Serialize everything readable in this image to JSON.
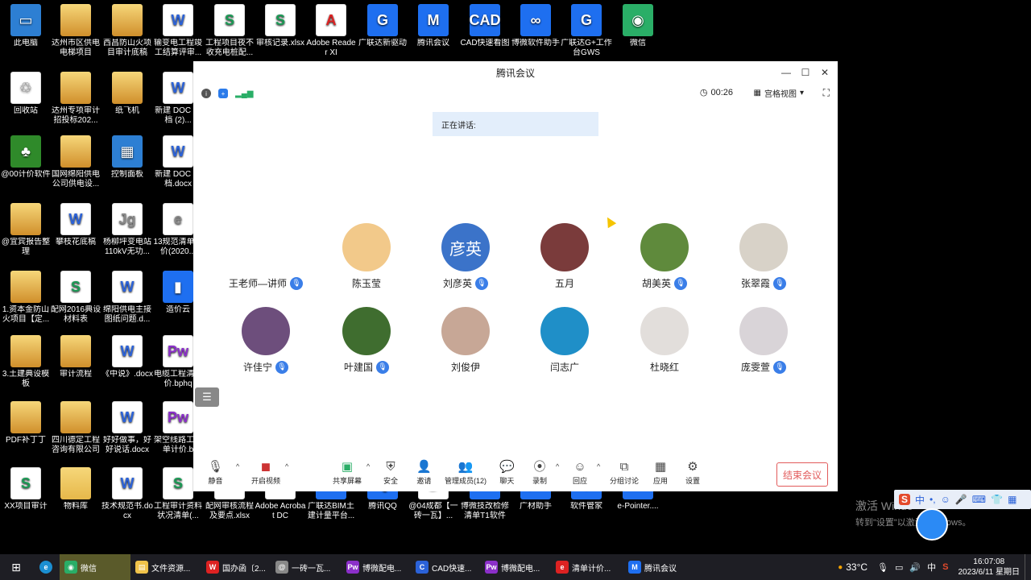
{
  "desktop_icons": [
    {
      "label": "此电脑",
      "type": "t-pc",
      "glyph": "▭"
    },
    {
      "label": "达州市区供电电梯项目",
      "type": "t-zip",
      "glyph": ""
    },
    {
      "label": "西昌防山火项目审计底稿",
      "type": "t-zip",
      "glyph": ""
    },
    {
      "label": "输变电工程竣工结算评审...",
      "type": "t-wps",
      "glyph": "W"
    },
    {
      "label": "工程项目夜不收充电桩配...",
      "type": "t-xls",
      "glyph": "S"
    },
    {
      "label": "审核记录.xlsx",
      "type": "t-xls",
      "glyph": "S"
    },
    {
      "label": "Adobe Reader XI",
      "type": "t-pdf",
      "glyph": "A"
    },
    {
      "label": "广联达新驱动",
      "type": "t-app",
      "glyph": "G"
    },
    {
      "label": "腾讯会议",
      "type": "t-app",
      "glyph": "M"
    },
    {
      "label": "CAD快速看图",
      "type": "t-app",
      "glyph": "CAD"
    },
    {
      "label": "博微软件助手",
      "type": "t-app",
      "glyph": "∞"
    },
    {
      "label": "广联达G+工作台GWS",
      "type": "t-app",
      "glyph": "G"
    },
    {
      "label": "微信",
      "type": "t-green",
      "glyph": "◉"
    },
    {
      "label": "回收站",
      "type": "t-doc",
      "glyph": "♲"
    },
    {
      "label": "达州专项审计招投标202...",
      "type": "t-zip",
      "glyph": ""
    },
    {
      "label": "纸飞机",
      "type": "t-zip",
      "glyph": ""
    },
    {
      "label": "新建 DOC 文档 (2)...",
      "type": "t-wps",
      "glyph": "W"
    },
    {
      "label": "@00计价软件",
      "type": "t-tree",
      "glyph": "♣"
    },
    {
      "label": "国网绵阳供电公司供电设...",
      "type": "t-zip",
      "glyph": ""
    },
    {
      "label": "控制面板",
      "type": "t-pc",
      "glyph": "▦"
    },
    {
      "label": "新建 DOC 文档.docx",
      "type": "t-wps",
      "glyph": "W"
    },
    {
      "label": "@宜宾报告整理",
      "type": "t-zip",
      "glyph": ""
    },
    {
      "label": "攀枝花底稿",
      "type": "t-wps",
      "glyph": "W"
    },
    {
      "label": "杨柳坪变电站110kV无功...",
      "type": "t-doc",
      "glyph": "Jg"
    },
    {
      "label": "13规范清单计价(2020...",
      "type": "t-doc",
      "glyph": "e"
    },
    {
      "label": "1.资本金防山火项目【定...",
      "type": "t-zip",
      "glyph": ""
    },
    {
      "label": "配网2016典设材料表",
      "type": "t-xls",
      "glyph": "S"
    },
    {
      "label": "绵阳供电主接图纸问题.d...",
      "type": "t-wps",
      "glyph": "W"
    },
    {
      "label": "造价云",
      "type": "t-app",
      "glyph": "▮"
    },
    {
      "label": "3.土建典设模板",
      "type": "t-zip",
      "glyph": ""
    },
    {
      "label": "审计流程",
      "type": "t-zip",
      "glyph": ""
    },
    {
      "label": "《中说》.docx",
      "type": "t-wps",
      "glyph": "W"
    },
    {
      "label": "电缆工程清计价.bphq",
      "type": "t-pw",
      "glyph": "Pw"
    },
    {
      "label": "PDF补丁丁",
      "type": "t-zip",
      "glyph": ""
    },
    {
      "label": "四川德定工程咨询有限公司",
      "type": "t-zip",
      "glyph": ""
    },
    {
      "label": "好好做事，好好说话.docx",
      "type": "t-wps",
      "glyph": "W"
    },
    {
      "label": "架空线路工清单计价.b",
      "type": "t-pw",
      "glyph": "Pw"
    },
    {
      "label": "XX项目审计",
      "type": "t-xls",
      "glyph": "S"
    },
    {
      "label": "物料库",
      "type": "t-folder",
      "glyph": ""
    },
    {
      "label": "技术规范书.docx",
      "type": "t-wps",
      "glyph": "W"
    },
    {
      "label": "工程审计资料状况清单(...",
      "type": "t-xls",
      "glyph": "S"
    },
    {
      "label": "配网审核流程及要点.xlsx",
      "type": "t-xls",
      "glyph": "S"
    },
    {
      "label": "Adobe Acrobat DC",
      "type": "t-pdf",
      "glyph": "A"
    },
    {
      "label": "广联达BIM土建计量平台...",
      "type": "t-app",
      "glyph": "G"
    },
    {
      "label": "腾讯QQ",
      "type": "t-app",
      "glyph": "Q"
    },
    {
      "label": "@04成都【一砖一瓦】...",
      "type": "t-doc",
      "glyph": "@"
    },
    {
      "label": "博微技改检修清单T1软件",
      "type": "t-app",
      "glyph": "B"
    },
    {
      "label": "广材助手",
      "type": "t-app",
      "glyph": "广"
    },
    {
      "label": "软件管家",
      "type": "t-app",
      "glyph": "◆"
    },
    {
      "label": "e-Pointer....",
      "type": "t-app",
      "glyph": "e"
    }
  ],
  "window": {
    "title": "腾讯会议",
    "timer": "00:26",
    "view_mode": "宫格视图",
    "speaking_label": "正在讲话:",
    "participants": [
      {
        "name": "王老师—讲师",
        "mic": true,
        "avatar_color": "#ffffff",
        "avatar_text": ""
      },
      {
        "name": "陈玉莹",
        "mic": false,
        "avatar_color": "#f2c98a",
        "avatar_text": ""
      },
      {
        "name": "刘彦英",
        "mic": true,
        "avatar_color": "#3b73c9",
        "avatar_text": "彦英"
      },
      {
        "name": "五月",
        "mic": false,
        "avatar_color": "#7a3b3b",
        "avatar_text": ""
      },
      {
        "name": "胡美英",
        "mic": true,
        "avatar_color": "#5f8a3c",
        "avatar_text": ""
      },
      {
        "name": "张翠霞",
        "mic": true,
        "avatar_color": "#d8d2c8",
        "avatar_text": ""
      },
      {
        "name": "许佳宁",
        "mic": true,
        "avatar_color": "#6d4e7c",
        "avatar_text": ""
      },
      {
        "name": "叶建国",
        "mic": true,
        "avatar_color": "#3f6d2f",
        "avatar_text": ""
      },
      {
        "name": "刘俊伊",
        "mic": false,
        "avatar_color": "#c7a796",
        "avatar_text": ""
      },
      {
        "name": "闫志广",
        "mic": false,
        "avatar_color": "#1f8fc8",
        "avatar_text": ""
      },
      {
        "name": "杜晓红",
        "mic": false,
        "avatar_color": "#e2dedb",
        "avatar_text": ""
      },
      {
        "name": "庞雯萱",
        "mic": true,
        "avatar_color": "#d9d4d8",
        "avatar_text": ""
      }
    ],
    "toolbar": {
      "mute": "静音",
      "video": "开启视频",
      "share": "共享屏幕",
      "security": "安全",
      "invite": "邀请",
      "members": "管理成员(12)",
      "chat": "聊天",
      "record": "录制",
      "reactions": "回应",
      "breakout": "分组讨论",
      "apps": "应用",
      "settings": "设置",
      "end": "结束会议"
    }
  },
  "activate_windows": {
    "line1": "激活 Windo",
    "line2": "转到\"设置\"以激活 Windows。"
  },
  "taskbar": {
    "items": [
      {
        "label": "微信",
        "color": "#2aae67",
        "glyph": "◉"
      },
      {
        "label": "文件资源...",
        "color": "#f0c24a",
        "glyph": "▤"
      },
      {
        "label": "国办函〔2...",
        "color": "#d22",
        "glyph": "W"
      },
      {
        "label": "一砖一瓦...",
        "color": "#888",
        "glyph": "@"
      },
      {
        "label": "博微配电...",
        "color": "#8b2fc9",
        "glyph": "Pw"
      },
      {
        "label": "CAD快速...",
        "color": "#2b62d8",
        "glyph": "C"
      },
      {
        "label": "博微配电...",
        "color": "#8b2fc9",
        "glyph": "Pw"
      },
      {
        "label": "清单计价...",
        "color": "#d22",
        "glyph": "e"
      },
      {
        "label": "腾讯会议",
        "color": "#1e6ff0",
        "glyph": "M"
      }
    ],
    "weather": "33°C",
    "ime": "中",
    "time": "16:07:08",
    "date": "2023/6/11 星期日"
  }
}
